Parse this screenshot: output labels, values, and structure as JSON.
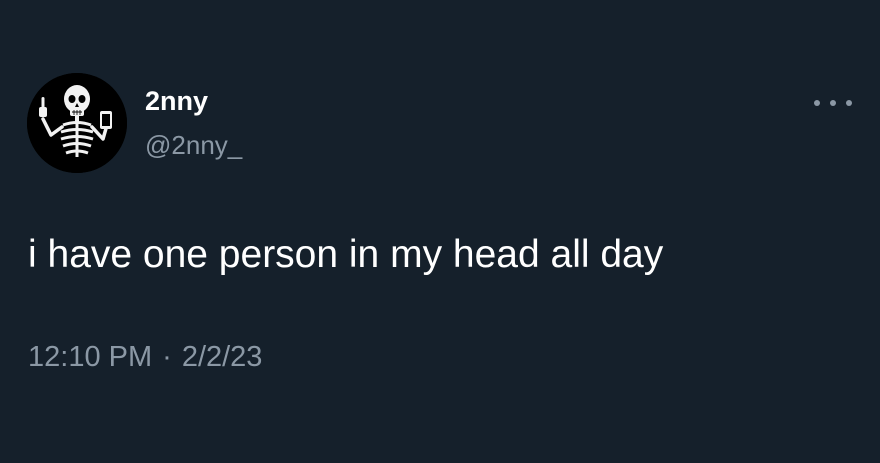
{
  "tweet": {
    "author": {
      "display_name": "2nny",
      "handle": "@2nny_",
      "avatar_icon": "skeleton-avatar-icon"
    },
    "more_icon": "more-options-icon",
    "text": "i have one person in my head all day",
    "time": "12:10 PM",
    "separator": "·",
    "date": "2/2/23"
  },
  "colors": {
    "background": "#15202b",
    "primary_text": "#ffffff",
    "secondary_text": "#8b98a5"
  }
}
